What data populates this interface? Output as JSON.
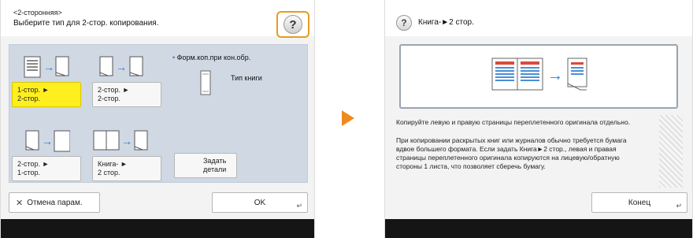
{
  "left": {
    "header_line1": "<2-сторонняя>",
    "header_line2": "Выберите тип для 2-стор. копирования.",
    "help_label": "?",
    "options": [
      {
        "label": "1-стор. ► 2-стор.",
        "line1": "1-стор. ►",
        "line2": "2-стор.",
        "selected": true
      },
      {
        "label": "2-стор. ► 2-стор.",
        "line1": "2-стор. ►",
        "line2": "2-стор.",
        "selected": false
      },
      {
        "label": "2-стор. ► 1-стор.",
        "line1": "2-стор. ►",
        "line2": "1-стор.",
        "selected": false
      },
      {
        "label": "Книга- ► 2 стор.",
        "line1": "Книга- ►",
        "line2": "2 стор.",
        "selected": false
      }
    ],
    "info_title": "Форм.коп.при кон.обр.",
    "info_value": "Тип книги",
    "set_details_line1": "Задать",
    "set_details_line2": "детали",
    "cancel_label": "Отмена парам.",
    "ok_label": "OK"
  },
  "right": {
    "help_label": "?",
    "title": "Книга-►2 стор.",
    "paragraph1": "Копируйте левую и правую страницы переплетенного оригинала отдельно.",
    "paragraph2": "При копировании раскрытых книг или журналов обычно требуется бумага вдвое большего формата. Если задать Книга►2 стор., левая и правая страницы переплетенного оригинала копируются на лицевую/обратную стороны 1 листа, что позволяет сберечь бумагу.",
    "end_label": "Конец"
  },
  "colors": {
    "selected": "#ffef1f",
    "help_highlight": "#e79b24",
    "arrow": "#2c7bd6",
    "next_arrow": "#f08a1e",
    "option_area": "#cfd8e3"
  }
}
